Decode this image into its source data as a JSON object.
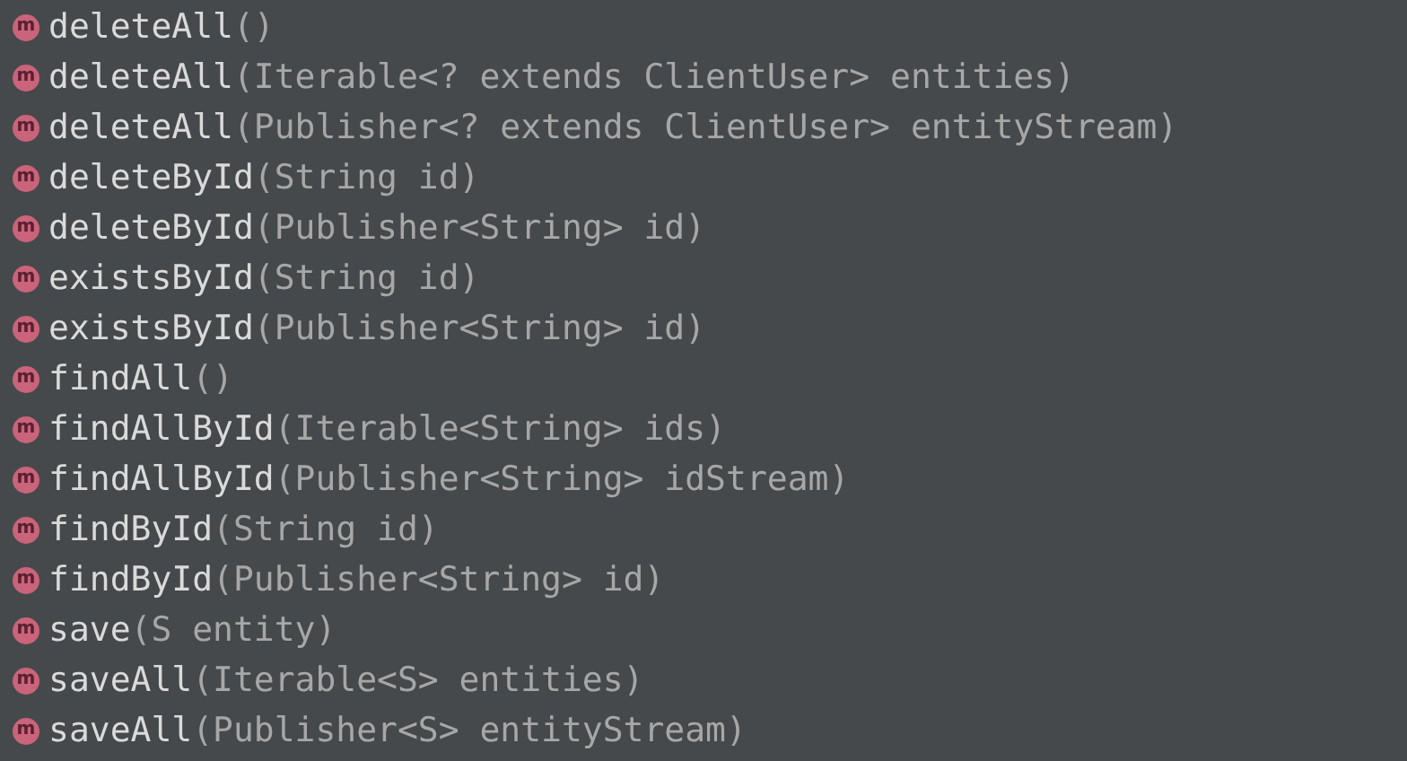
{
  "items": [
    {
      "icon": "m",
      "name": "deleteAll",
      "params": "()"
    },
    {
      "icon": "m",
      "name": "deleteAll",
      "params": "(Iterable<? extends ClientUser> entities)"
    },
    {
      "icon": "m",
      "name": "deleteAll",
      "params": "(Publisher<? extends ClientUser> entityStream)"
    },
    {
      "icon": "m",
      "name": "deleteById",
      "params": "(String id)"
    },
    {
      "icon": "m",
      "name": "deleteById",
      "params": "(Publisher<String> id)"
    },
    {
      "icon": "m",
      "name": "existsById",
      "params": "(String id)"
    },
    {
      "icon": "m",
      "name": "existsById",
      "params": "(Publisher<String> id)"
    },
    {
      "icon": "m",
      "name": "findAll",
      "params": "()"
    },
    {
      "icon": "m",
      "name": "findAllById",
      "params": "(Iterable<String> ids)"
    },
    {
      "icon": "m",
      "name": "findAllById",
      "params": "(Publisher<String> idStream)"
    },
    {
      "icon": "m",
      "name": "findById",
      "params": "(String id)"
    },
    {
      "icon": "m",
      "name": "findById",
      "params": "(Publisher<String> id)"
    },
    {
      "icon": "m",
      "name": "save",
      "params": "(S entity)"
    },
    {
      "icon": "m",
      "name": "saveAll",
      "params": "(Iterable<S> entities)"
    },
    {
      "icon": "m",
      "name": "saveAll",
      "params": "(Publisher<S> entityStream)"
    }
  ]
}
